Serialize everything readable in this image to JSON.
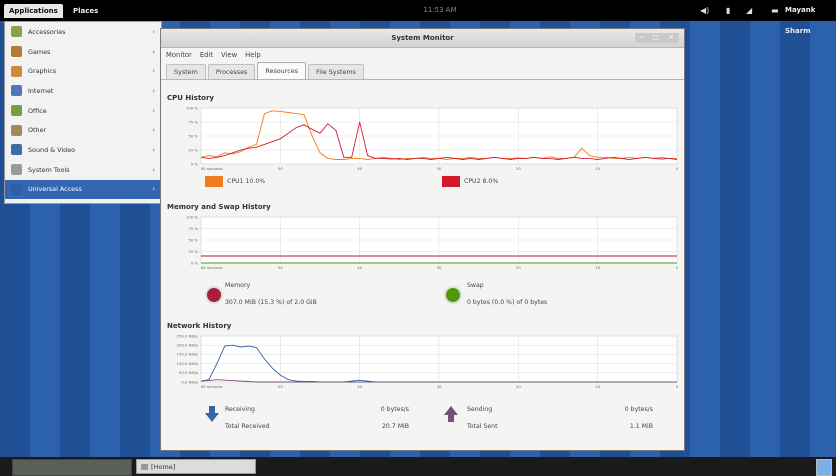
{
  "topbar": {
    "applications_label": "Applications",
    "places_label": "Places",
    "clock": "11:53 AM",
    "user_name": "Mayank Sharm"
  },
  "menu": {
    "items": [
      {
        "label": "Accessories",
        "icon": "accessories-icon",
        "color": "#8aa04a"
      },
      {
        "label": "Games",
        "icon": "games-icon",
        "color": "#b57b34"
      },
      {
        "label": "Graphics",
        "icon": "graphics-icon",
        "color": "#d0883a"
      },
      {
        "label": "Internet",
        "icon": "internet-icon",
        "color": "#4b76b8"
      },
      {
        "label": "Office",
        "icon": "office-icon",
        "color": "#7a9e3c"
      },
      {
        "label": "Other",
        "icon": "other-icon",
        "color": "#a08b5a"
      },
      {
        "label": "Sound & Video",
        "icon": "sound-video-icon",
        "color": "#3a6ea5"
      },
      {
        "label": "System Tools",
        "icon": "system-tools-icon",
        "color": "#9a9a9a"
      },
      {
        "label": "Universal Access",
        "icon": "universal-access-icon",
        "color": "#2f5fa8"
      }
    ],
    "active_index": 8
  },
  "window": {
    "title": "System Monitor",
    "menubar": [
      "Monitor",
      "Edit",
      "View",
      "Help"
    ],
    "tabs": [
      "System",
      "Processes",
      "Resources",
      "File Systems"
    ],
    "active_tab": 2
  },
  "cpu": {
    "title": "CPU History",
    "ticks_y": [
      "100 %",
      "75 %",
      "50 %",
      "25 %",
      "0 %"
    ],
    "ticks_x": [
      "60 seconds",
      "50",
      "40",
      "30",
      "20",
      "10",
      "0"
    ],
    "legend": [
      {
        "label": "CPU1 10.0%",
        "color": "#f07c1e"
      },
      {
        "label": "CPU2 8.0%",
        "color": "#d21c2e"
      }
    ]
  },
  "memory": {
    "title": "Memory and Swap History",
    "ticks_y": [
      "100 %",
      "75 %",
      "50 %",
      "25 %",
      "0 %"
    ],
    "ticks_x": [
      "60 seconds",
      "50",
      "40",
      "30",
      "20",
      "10",
      "0"
    ],
    "memory_label": "Memory",
    "memory_value": "307.0 MiB (15.3 %) of 2.0 GiB",
    "swap_label": "Swap",
    "swap_value": "0 bytes (0.0 %) of 0 bytes",
    "memory_color": "#a71f3d",
    "swap_color": "#4e9a06"
  },
  "network": {
    "title": "Network History",
    "ticks_y": [
      "250.0 KiB/s",
      "200.0 KiB/s",
      "150.0 KiB/s",
      "100.0 KiB/s",
      "50.0 KiB/s",
      "0.0 KiB/s"
    ],
    "ticks_x": [
      "60 seconds",
      "50",
      "40",
      "30",
      "20",
      "10",
      "0"
    ],
    "receiving_label": "Receiving",
    "receiving_value": "0 bytes/s",
    "total_received_label": "Total Received",
    "total_received_value": "20.7 MiB",
    "sending_label": "Sending",
    "sending_value": "0 bytes/s",
    "total_sent_label": "Total Sent",
    "total_sent_value": "1.1 MiB",
    "receiving_color": "#3465a4",
    "sending_color": "#75507b"
  },
  "taskbar": {
    "home_label": "[Home]"
  }
}
